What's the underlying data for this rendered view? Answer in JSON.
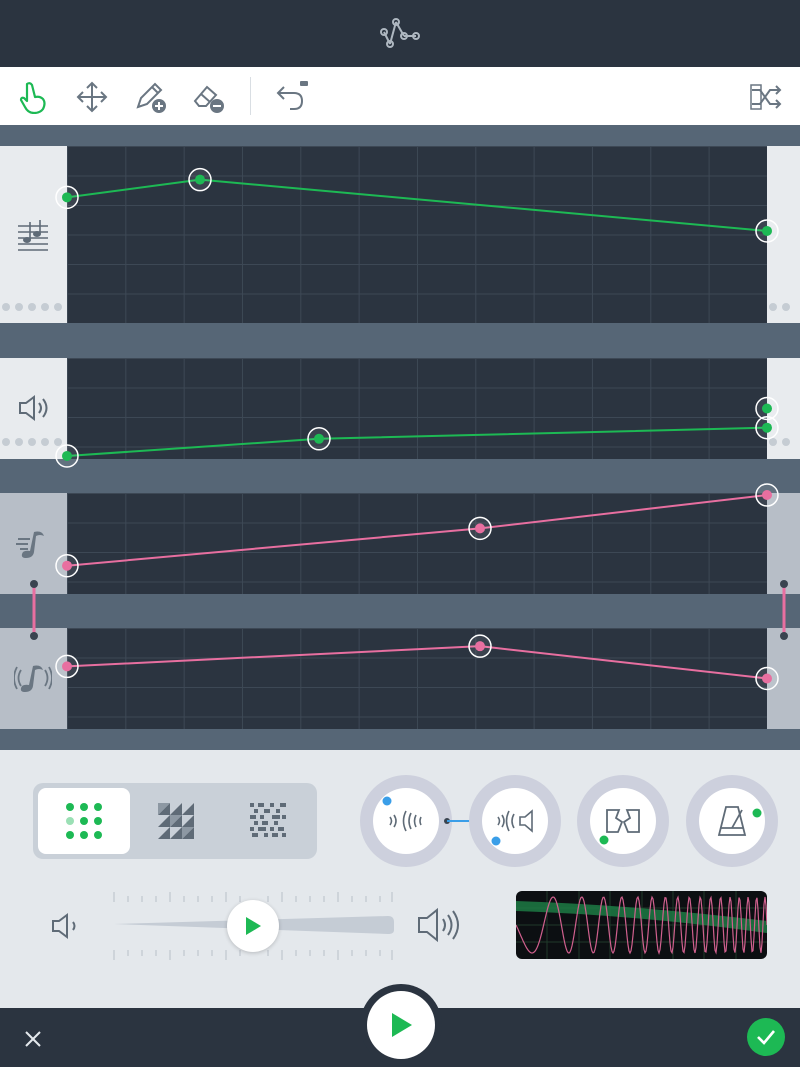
{
  "app": {
    "logo_icon": "nodes-graph-icon"
  },
  "toolbar": {
    "tools": [
      {
        "id": "touch",
        "icon": "pointer-hand-icon",
        "active": true
      },
      {
        "id": "move",
        "icon": "move-arrows-icon"
      },
      {
        "id": "add-point",
        "icon": "pencil-add-icon"
      },
      {
        "id": "erase-point",
        "icon": "eraser-remove-icon"
      },
      {
        "id": "undo",
        "icon": "undo-arrow-icon"
      },
      {
        "id": "shuffle",
        "icon": "shuffle-icon"
      }
    ]
  },
  "lanes": [
    {
      "id": "pitch",
      "icon": "notes-staff-icon",
      "color": "#1db954",
      "points": [
        {
          "t": 0.0,
          "v": 0.71
        },
        {
          "t": 0.19,
          "v": 0.81
        },
        {
          "t": 1.0,
          "v": 0.52
        }
      ]
    },
    {
      "id": "volume",
      "icon": "speaker-icon",
      "color": "#1db954",
      "points": [
        {
          "t": 0.0,
          "v": 0.03
        },
        {
          "t": 0.36,
          "v": 0.2
        },
        {
          "t": 1.0,
          "v": 0.31
        },
        {
          "t": 1.0,
          "v": 0.5
        }
      ]
    },
    {
      "id": "tempo",
      "icon": "fast-note-icon",
      "color": "#e86fa0",
      "points": [
        {
          "t": 0.0,
          "v": 0.28
        },
        {
          "t": 0.59,
          "v": 0.65
        },
        {
          "t": 1.0,
          "v": 0.98
        }
      ]
    },
    {
      "id": "vibrato",
      "icon": "vibrato-note-icon",
      "color": "#e86fa0",
      "points": [
        {
          "t": 0.0,
          "v": 0.62
        },
        {
          "t": 0.59,
          "v": 0.82
        },
        {
          "t": 1.0,
          "v": 0.5
        }
      ]
    }
  ],
  "patterns": [
    {
      "id": "dots",
      "icon": "dot-grid-icon",
      "active": true
    },
    {
      "id": "triangles",
      "icon": "triangle-pattern-icon"
    },
    {
      "id": "noise",
      "icon": "noise-pattern-icon"
    }
  ],
  "knobs": [
    {
      "id": "echo-in",
      "icon": "sound-waves-in-icon"
    },
    {
      "id": "echo-out",
      "icon": "speaker-waves-icon"
    },
    {
      "id": "distortion",
      "icon": "distortion-icon"
    },
    {
      "id": "metronome",
      "icon": "metronome-icon"
    }
  ],
  "volume_slider": {
    "value": 0.5,
    "min_icon": "speaker-low-icon",
    "max_icon": "speaker-high-icon"
  },
  "footer": {
    "close_icon": "close-icon",
    "play_icon": "play-icon",
    "confirm_icon": "check-icon",
    "accent": "#1db954"
  }
}
